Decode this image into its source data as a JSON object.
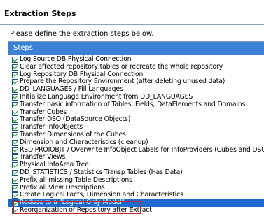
{
  "header": {
    "title": "Extraction Steps"
  },
  "description": "Please define the extraction steps below.",
  "grid": {
    "column_header": "Steps",
    "selected_index": 23,
    "steps": [
      {
        "label": "Log Source DB Physical Connection",
        "checked": true
      },
      {
        "label": "Clear affected repository tables or recreate the whole repository",
        "checked": true
      },
      {
        "label": "Log Repository DB Physical Connection",
        "checked": true
      },
      {
        "label": "Prepare the Repository Environment (after deleting unused data)",
        "checked": true
      },
      {
        "label": "DD_LANGUAGES / Fill Languages",
        "checked": true
      },
      {
        "label": "Initialize Language Environment from DD_LANGUAGES",
        "checked": true
      },
      {
        "label": "Transfer basic information of Tables, Fields, DataElements and Domains",
        "checked": true
      },
      {
        "label": "Transfer Cubes",
        "checked": true
      },
      {
        "label": "Transfer DSO (DataSource Objects)",
        "checked": true
      },
      {
        "label": "Transfer InfoObjects",
        "checked": true
      },
      {
        "label": "Transfer Dimensions of the Cubes",
        "checked": true
      },
      {
        "label": "Dimension and Characteristics (cleanup)",
        "checked": true
      },
      {
        "label": "RSDIPROIOBJT / Overwrite InfoObject Labels for InfoProviders (Cubes and DSOs)",
        "checked": true
      },
      {
        "label": "Transfer Views",
        "checked": true
      },
      {
        "label": "Physical InfoArea Tree",
        "checked": true
      },
      {
        "label": "DD_STATISTICS / Statistics Transp Tables (Has Data)",
        "checked": true
      },
      {
        "label": "Prefix all missing Table Descriptions",
        "checked": true
      },
      {
        "label": "Prefix all View Descriptions",
        "checked": true
      },
      {
        "label": "Create Logical Facts, Dimension and Characteristics",
        "checked": true
      },
      {
        "label": "Reduce to a \"Logical Only Model\"",
        "checked": true
      },
      {
        "label": "Reorganization of Repository after Extract",
        "checked": true
      }
    ]
  },
  "colors": {
    "header_blue": "#3b82d7",
    "selection_blue": "#1d6ad0",
    "highlight_red": "#c0272d",
    "check_green": "#21a121"
  },
  "icons": {
    "checkbox": "checkbox-checked-icon"
  }
}
